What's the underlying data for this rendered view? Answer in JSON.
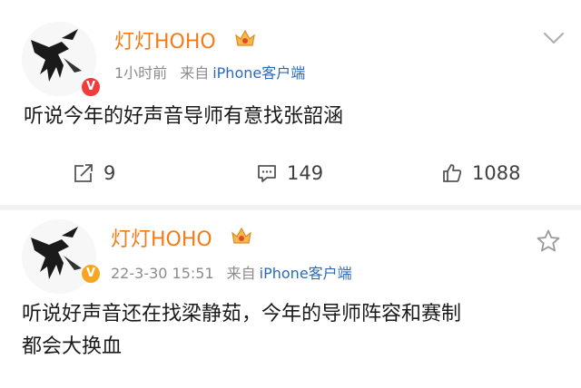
{
  "posts": [
    {
      "author": "灯灯HOHO",
      "time": "1小时前",
      "source_prefix": "来自",
      "source_client": "iPhone客户端",
      "verified_badge": "V",
      "text": "听说今年的好声音导师有意找张韶涵",
      "actions": {
        "repost": "9",
        "comments": "149",
        "likes": "1088"
      },
      "corner_icon": "chevron-down-icon"
    },
    {
      "author": "灯灯HOHO",
      "time": "22-3-30 15:51",
      "source_prefix": "来自",
      "source_client": "iPhone客户端",
      "verified_badge": "V",
      "text_line1": "听说好声音还在找梁静茹，今年的导师阵容和赛制",
      "text_line2": "都会大换血",
      "corner_icon": "star-icon"
    }
  ],
  "colors": {
    "name": "#f07c1a",
    "link": "#2c6ab8",
    "meta": "#8c8c8c",
    "badge_red": "#f23b3b",
    "badge_orange": "#f6a623"
  }
}
